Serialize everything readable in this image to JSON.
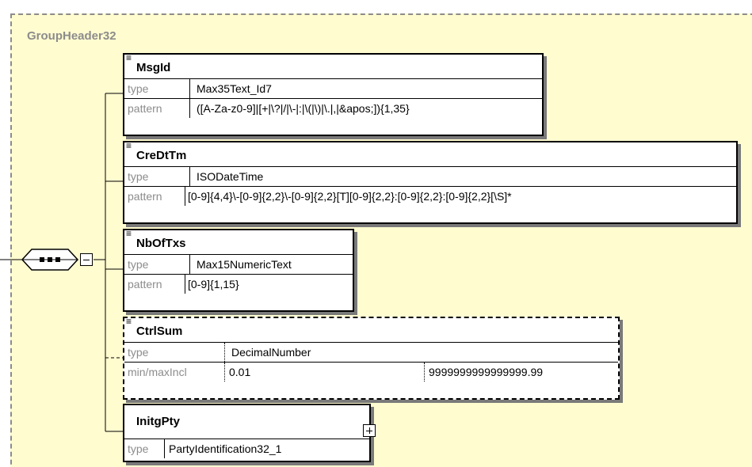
{
  "group": {
    "name": "GroupHeader32"
  },
  "row_labels": {
    "type": "type",
    "pattern": "pattern",
    "minmax": "min/maxIncl"
  },
  "elements": [
    {
      "name": "MsgId",
      "type": "Max35Text_Id7",
      "pattern": "([A-Za-z0-9]|[+|\\?|/|\\-|:|\\(|\\)|\\.|,|&apos;]){1,35}",
      "optional": false
    },
    {
      "name": "CreDtTm",
      "type": "ISODateTime",
      "pattern": "[0-9]{4,4}\\-[0-9]{2,2}\\-[0-9]{2,2}[T][0-9]{2,2}:[0-9]{2,2}:[0-9]{2,2}[\\S]*",
      "optional": false
    },
    {
      "name": "NbOfTxs",
      "type": "Max15NumericText",
      "pattern": "[0-9]{1,15}",
      "optional": false
    },
    {
      "name": "CtrlSum",
      "type": "DecimalNumber",
      "min_incl": "0.01",
      "max_incl": "9999999999999999.99",
      "optional": true
    },
    {
      "name": "InitgPty",
      "type": "PartyIdentification32_1",
      "optional": false
    }
  ],
  "icons": {
    "sequence": "sequence-compositor-icon",
    "collapse": "collapse-icon",
    "expand": "expand-icon",
    "annotation": "documentation-icon"
  }
}
